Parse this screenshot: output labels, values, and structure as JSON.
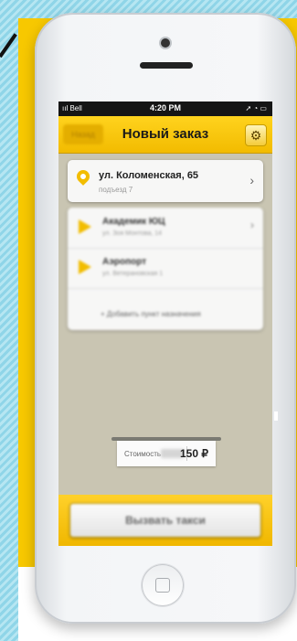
{
  "colors": {
    "accent": "#f7c800",
    "frame_bg": "#8fd5e8"
  },
  "status_bar": {
    "carrier": "ııl Bell",
    "time": "4:20 PM",
    "icons": "➚ ◔ ▭"
  },
  "nav": {
    "back_label": "Назад",
    "title": "Новый заказ",
    "settings_icon": "gear-icon"
  },
  "pickup": {
    "address": "ул. Коломенская, 65",
    "entrance": "подъезд 7"
  },
  "stops": [
    {
      "name": "Академик ЮЦ",
      "sub": "ул. Зоя Монтова, 14"
    },
    {
      "name": "Аэропорт",
      "sub": "ул. Ветерановская 1"
    }
  ],
  "add_stop_label": "+ Добавить пункт назначения",
  "fare": {
    "label": "Стоимость",
    "price": "150 ₽"
  },
  "call_button": {
    "label": "Вызвать такси"
  }
}
